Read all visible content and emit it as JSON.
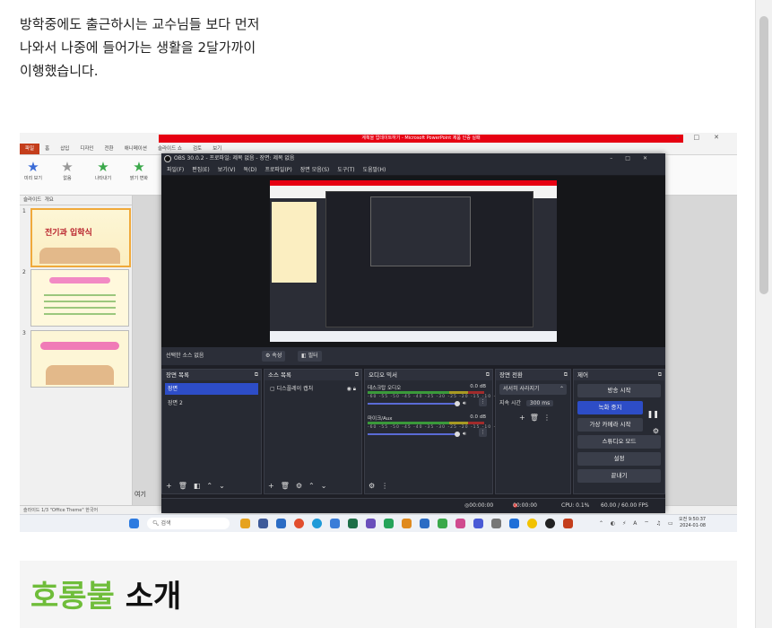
{
  "article": {
    "paragraph_lines": [
      "방학중에도 출근하시는 교수님들 보다 먼저",
      "나와서 나중에 들어가는 생활을 2달가까이",
      "이행했습니다."
    ],
    "section_heading_green": "호롱불",
    "section_heading_black": "소개"
  },
  "screenshot": {
    "ppt": {
      "title_bar": "계획을 업데이트하기 - Microsoft PowerPoint 제품 인증 실패",
      "tabs": [
        "파일",
        "홈",
        "삽입",
        "디자인",
        "전환",
        "애니메이션",
        "슬라이드 쇼",
        "검토",
        "보기"
      ],
      "ribbon_buttons": [
        "미리 보기",
        "없음",
        "나타내기",
        "밝기 변화"
      ],
      "panel_tabs": [
        "슬라이드",
        "개요"
      ],
      "slide_numbers": [
        "1",
        "2",
        "3"
      ],
      "slide1_title": "전기과 입학식",
      "status_bar": "슬라이드 1/3   \"Office Theme\"   한국어",
      "zoom_fragment": "여기"
    },
    "obs": {
      "title": "OBS 30.0.2 - 프로파일: 제목 없음 - 장면: 제목 없음",
      "menu": [
        "파일(F)",
        "편집(E)",
        "보기(V)",
        "독(D)",
        "프로파일(P)",
        "장면 모음(S)",
        "도구(T)",
        "도움말(H)"
      ],
      "source_toolbar_label": "선택한 소스 없음",
      "properties_btn": "속성",
      "filters_btn": "필터",
      "scenes_dock": {
        "title": "장면 목록",
        "items": [
          "장면",
          "장면 2"
        ]
      },
      "sources_dock": {
        "title": "소스 목록",
        "items": [
          "디스플레이 캡처"
        ]
      },
      "mixer_dock": {
        "title": "오디오 믹서",
        "channels": [
          {
            "name": "데스크탑 오디오",
            "db": "0.0 dB"
          },
          {
            "name": "마이크/Aux",
            "db": "0.0 dB"
          }
        ],
        "ticks": "-60 -55 -50 -45 -40 -35 -30 -25 -20 -15 -10 -5 0"
      },
      "transitions_dock": {
        "title": "장면 전환",
        "transition": "서서히 사라지기",
        "duration_label": "지속 시간",
        "duration": "300 ms"
      },
      "controls_dock": {
        "title": "제어",
        "buttons": [
          "방송 시작",
          "녹화 중지",
          "가상 카메라 시작",
          "스튜디오 모드",
          "설정",
          "끝내기"
        ]
      },
      "status": {
        "stream_time": "00:00:00",
        "rec_time": "00:00:00",
        "cpu": "CPU: 0.1%",
        "fps": "60.00 / 60.00 FPS"
      }
    },
    "taskbar": {
      "search": "검색",
      "time": "오전 9:50:37",
      "date": "2024-01-08"
    }
  },
  "colors": {
    "red_title": "#e60012",
    "obs_bg": "#1e1f26",
    "obs_accent": "#2d4dc7",
    "heading_green": "#6fbd3a"
  }
}
